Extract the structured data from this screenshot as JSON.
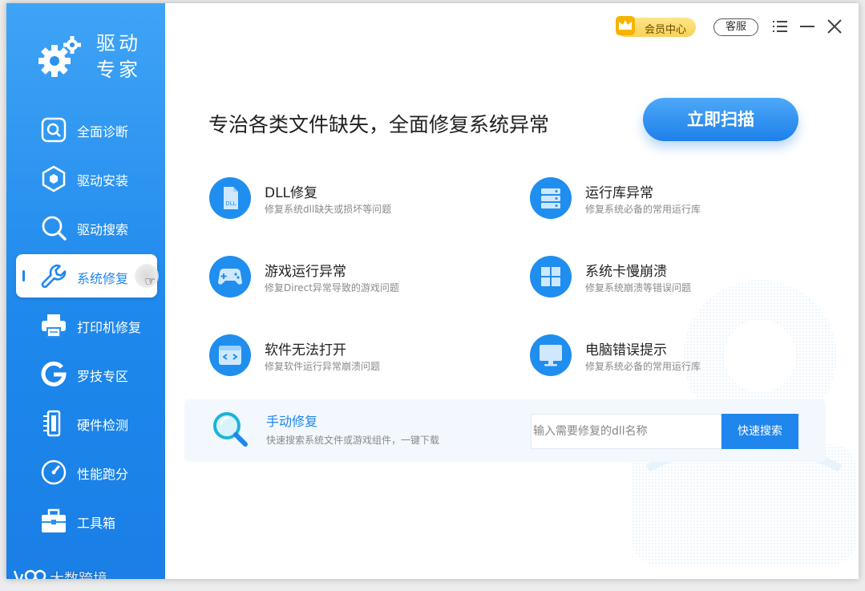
{
  "app": {
    "name_line1": "驱动",
    "name_line2": "专家"
  },
  "titlebar": {
    "vip_label": "会员中心",
    "service_label": "客服",
    "menu_icon": "menu-icon",
    "minimize_icon": "minimize-icon",
    "close_icon": "close-icon"
  },
  "sidebar": {
    "active_index": 3,
    "items": [
      {
        "label": "全面诊断",
        "icon": "diagnosis-icon"
      },
      {
        "label": "驱动安装",
        "icon": "driver-install-icon"
      },
      {
        "label": "驱动搜索",
        "icon": "driver-search-icon"
      },
      {
        "label": "系统修复",
        "icon": "wrench-icon"
      },
      {
        "label": "打印机修复",
        "icon": "printer-icon"
      },
      {
        "label": "罗技专区",
        "icon": "logitech-icon"
      },
      {
        "label": "硬件检测",
        "icon": "hardware-icon"
      },
      {
        "label": "性能跑分",
        "icon": "gauge-icon"
      },
      {
        "label": "工具箱",
        "icon": "toolbox-icon"
      }
    ]
  },
  "main": {
    "headline": "专治各类文件缺失，全面修复系统异常",
    "scan_button": "立即扫描",
    "features": [
      {
        "title": "DLL修复",
        "desc": "修复系统dll缺失或损坏等问题",
        "icon": "dll-file-icon"
      },
      {
        "title": "运行库异常",
        "desc": "修复系统必备的常用运行库",
        "icon": "runtime-icon"
      },
      {
        "title": "游戏运行异常",
        "desc": "修复Direct异常导致的游戏问题",
        "icon": "gamepad-icon"
      },
      {
        "title": "系统卡慢崩溃",
        "desc": "修复系统崩溃等错误问题",
        "icon": "windows-icon"
      },
      {
        "title": "软件无法打开",
        "desc": "修复软件运行异常崩溃问题",
        "icon": "app-window-icon"
      },
      {
        "title": "电脑错误提示",
        "desc": "修复系统必备的常用运行库",
        "icon": "monitor-icon"
      }
    ],
    "manual": {
      "title": "手动修复",
      "desc": "快速搜索系统文件或游戏组件，一键下载",
      "search_placeholder": "输入需要修复的dll名称",
      "search_button": "快速搜索"
    }
  },
  "watermark": {
    "text": "大数跨境"
  },
  "colors": {
    "accent": "#1f86ee",
    "sidebar_top": "#3fa4f6",
    "sidebar_bottom": "#1a7fe6",
    "vip_gold": "#f7d257"
  }
}
